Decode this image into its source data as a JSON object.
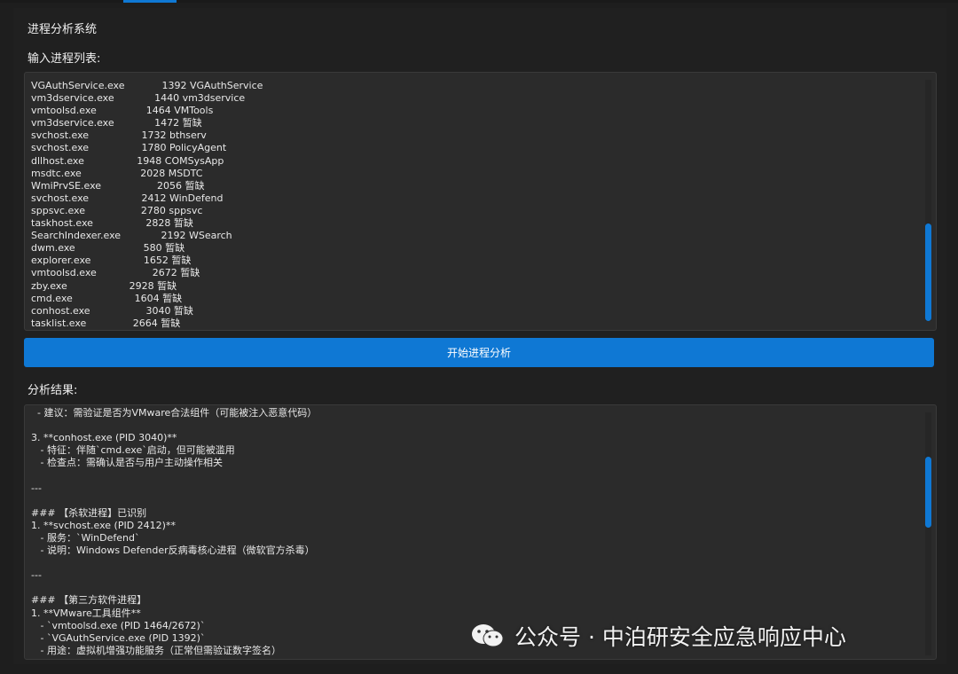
{
  "app": {
    "title": "进程分析系统",
    "process_list_label": "输入进程列表:",
    "result_label": "分析结果:",
    "start_button_label": "开始进程分析"
  },
  "process_lines": [
    "VGAuthService.exe            1392 VGAuthService",
    "vm3dservice.exe             1440 vm3dservice",
    "vmtoolsd.exe                1464 VMTools",
    "vm3dservice.exe             1472 暂缺",
    "svchost.exe                 1732 bthserv",
    "svchost.exe                 1780 PolicyAgent",
    "dllhost.exe                 1948 COMSysApp",
    "msdtc.exe                   2028 MSDTC",
    "WmiPrvSE.exe                  2056 暂缺",
    "svchost.exe                 2412 WinDefend",
    "sppsvc.exe                  2780 sppsvc",
    "taskhost.exe                 2828 暂缺",
    "SearchIndexer.exe             2192 WSearch",
    "dwm.exe                      580 暂缺",
    "explorer.exe                 1652 暂缺",
    "vmtoolsd.exe                  2672 暂缺",
    "zby.exe                    2928 暂缺",
    "cmd.exe                    1604 暂缺",
    "conhost.exe                  3040 暂缺",
    "tasklist.exe               2664 暂缺"
  ],
  "result_lines": [
    "  - 建议：需验证是否为VMware合法组件（可能被注入恶意代码）",
    "",
    "3. **conhost.exe (PID 3040)**",
    "   - 特征：伴随`cmd.exe`启动，但可能被滥用",
    "   - 检查点：需确认是否与用户主动操作相关",
    "",
    "---",
    "",
    "### 【杀软进程】已识别",
    "1. **svchost.exe (PID 2412)**",
    "   - 服务：`WinDefend`",
    "   - 说明：Windows Defender反病毒核心进程（微软官方杀毒）",
    "",
    "---",
    "",
    "### 【第三方软件进程】",
    "1. **VMware工具组件**",
    "   - `vmtoolsd.exe (PID 1464/2672)`",
    "   - `VGAuthService.exe (PID 1392)`",
    "   - 用途：虚拟机增强功能服务（正常但需验证数字签名）"
  ],
  "watermark": {
    "text": "公众号 · 中泊研安全应急响应中心"
  },
  "colors": {
    "accent": "#0f78d4",
    "background": "#1e1e1e",
    "textbox": "#2b2b2b"
  }
}
